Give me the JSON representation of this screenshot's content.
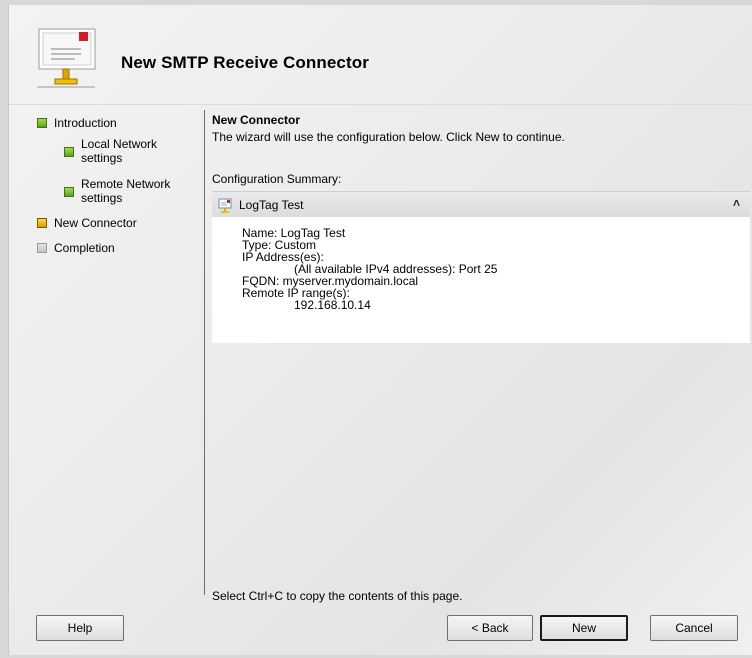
{
  "wizard": {
    "title": "New SMTP Receive Connector"
  },
  "nav": {
    "items": [
      {
        "label": "Introduction",
        "status": "complete"
      },
      {
        "label_line1": "Local Network",
        "label_line2": "settings",
        "status": "complete"
      },
      {
        "label_line1": "Remote Network",
        "label_line2": "settings",
        "status": "complete"
      },
      {
        "label": "New Connector",
        "status": "current"
      },
      {
        "label": "Completion",
        "status": "pending"
      }
    ]
  },
  "main": {
    "heading": "New Connector",
    "description": "The wizard will use the configuration below.  Click New to continue.",
    "config_label": "Configuration Summary:",
    "summary": {
      "name": "LogTag Test",
      "lines": {
        "name": "Name: LogTag Test",
        "type": "Type: Custom",
        "ip_label": "IP Address(es):",
        "ip_value": "(All available IPv4 addresses): Port 25",
        "fqdn": "FQDN: myserver.mydomain.local",
        "remote_label": "Remote IP range(s):",
        "remote_value": "192.168.10.14"
      }
    },
    "hint": "Select Ctrl+C to copy the contents of this page."
  },
  "buttons": {
    "help": "Help",
    "back": "< Back",
    "new": "New",
    "cancel": "Cancel"
  },
  "colors": {
    "complete": "#6cc22a",
    "current": "#f2b600",
    "pending": "#cfcfcf"
  }
}
